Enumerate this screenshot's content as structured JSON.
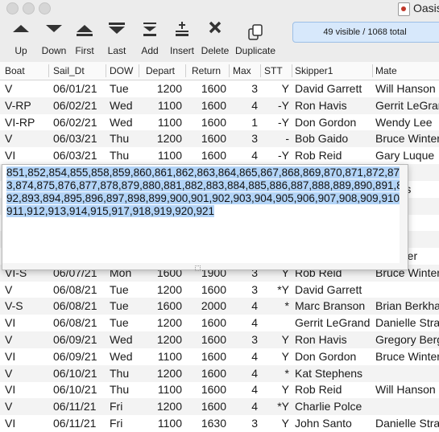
{
  "window": {
    "title": "Oasis"
  },
  "toolbar": {
    "buttons": [
      {
        "label": "Up"
      },
      {
        "label": "Down"
      },
      {
        "label": "First"
      },
      {
        "label": "Last"
      },
      {
        "label": "Add"
      },
      {
        "label": "Insert"
      },
      {
        "label": "Delete"
      },
      {
        "label": "Duplicate"
      }
    ],
    "status": "49 visible / 1068 total"
  },
  "table": {
    "columns": [
      "Boat",
      "Sail_Dt",
      "DOW",
      "Depart",
      "Return",
      "Max",
      "STT",
      "Skipper1",
      "Mate"
    ],
    "rows": [
      [
        "V",
        "06/01/21",
        "Tue",
        "1200",
        "1600",
        "3",
        "Y",
        "David Garrett",
        "Will Hanson"
      ],
      [
        "V-RP",
        "06/02/21",
        "Wed",
        "1100",
        "1600",
        "4",
        "-Y",
        "Ron Havis",
        "Gerrit LeGrand"
      ],
      [
        "VI-RP",
        "06/02/21",
        "Wed",
        "1100",
        "1600",
        "1",
        "-Y",
        "Don Gordon",
        "Wendy Lee"
      ],
      [
        "V",
        "06/03/21",
        "Thu",
        "1200",
        "1600",
        "3",
        "-",
        "Bob Gaido",
        "Bruce Winter"
      ],
      [
        "VI",
        "06/03/21",
        "Thu",
        "1100",
        "1600",
        "4",
        "-Y",
        "Rob Reid",
        "Gary Luque"
      ],
      [
        "",
        "",
        "",
        "",
        "",
        "",
        "",
        "",
        "Ibsen"
      ],
      [
        "",
        "",
        "",
        "",
        "",
        "",
        "",
        "",
        "te Pars"
      ],
      [
        "",
        "",
        "",
        "",
        "",
        "",
        "",
        "",
        ""
      ],
      [
        "",
        "",
        "",
        "",
        "",
        "",
        "",
        "",
        ""
      ],
      [
        "",
        "",
        "",
        "",
        "",
        "",
        "",
        "",
        ""
      ],
      [
        "",
        "",
        "",
        "",
        "",
        "",
        "",
        "",
        "e Winter"
      ],
      [
        "VI-S",
        "06/07/21",
        "Mon",
        "1600",
        "1900",
        "3",
        "Y",
        "Rob Reid",
        "Bruce Winter"
      ],
      [
        "V",
        "06/08/21",
        "Tue",
        "1200",
        "1600",
        "3",
        "*Y",
        "David Garrett",
        ""
      ],
      [
        "V-S",
        "06/08/21",
        "Tue",
        "1600",
        "2000",
        "4",
        "*",
        "Marc Branson",
        "Brian Berkhard"
      ],
      [
        "VI",
        "06/08/21",
        "Tue",
        "1200",
        "1600",
        "4",
        "",
        "Gerrit LeGrand",
        "Danielle Strat"
      ],
      [
        "V",
        "06/09/21",
        "Wed",
        "1200",
        "1600",
        "3",
        "Y",
        "Ron Havis",
        "Gregory Berg"
      ],
      [
        "VI",
        "06/09/21",
        "Wed",
        "1100",
        "1600",
        "4",
        "Y",
        "Don Gordon",
        "Bruce Winter"
      ],
      [
        "V",
        "06/10/21",
        "Thu",
        "1200",
        "1600",
        "4",
        "*",
        "Kat Stephens",
        ""
      ],
      [
        "VI",
        "06/10/21",
        "Thu",
        "1100",
        "1600",
        "4",
        "Y",
        "Rob Reid",
        "Will Hanson"
      ],
      [
        "V",
        "06/11/21",
        "Fri",
        "1200",
        "1600",
        "4",
        "*Y",
        "Charlie Polce",
        ""
      ],
      [
        "VI",
        "06/11/21",
        "Fri",
        "1100",
        "1630",
        "3",
        "Y",
        "John Santo",
        "Danielle Strat"
      ]
    ]
  },
  "popup": {
    "text": "851,852,854,855,858,859,860,861,862,863,864,865,867,868,869,870,871,872,873,874,875,876,877,878,879,880,881,882,883,884,885,886,887,888,889,890,891,892,893,894,895,896,897,898,899,900,901,902,903,904,905,906,907,908,909,910,911,912,913,914,915,917,918,919,920,921"
  },
  "icons": [
    "triangle-up-icon",
    "triangle-down-icon",
    "first-icon",
    "last-icon",
    "add-icon",
    "insert-icon",
    "delete-icon",
    "duplicate-icon"
  ],
  "colors": {
    "selection": "#b3d4f7",
    "status_bg": "#d7e8fb"
  }
}
